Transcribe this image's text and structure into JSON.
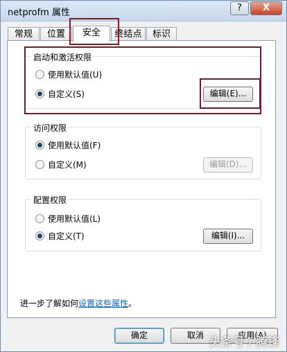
{
  "window": {
    "title": "netprofm 属性",
    "help_label": "?",
    "close_label": "X"
  },
  "tabs": [
    {
      "label": "常规"
    },
    {
      "label": "位置"
    },
    {
      "label": "安全"
    },
    {
      "label": "终结点"
    },
    {
      "label": "标识"
    }
  ],
  "active_tab": "安全",
  "launch_group": {
    "title": "启动和激活权限",
    "default_option": "使用默认值(U)",
    "custom_option": "自定义(S)",
    "edit_button": "编辑(E)...",
    "selected": "custom"
  },
  "access_group": {
    "title": "访问权限",
    "default_option": "使用默认值(F)",
    "custom_option": "自定义(M)",
    "edit_button": "编辑(D)...",
    "selected": "default"
  },
  "config_group": {
    "title": "配置权限",
    "default_option": "使用默认值(L)",
    "custom_option": "自定义(T)",
    "edit_button": "编辑(I)...",
    "selected": "custom"
  },
  "learn_more": {
    "prefix": "进一步了解如何",
    "link_text": "设置这些属性",
    "suffix": "。"
  },
  "buttons": {
    "ok": "确定",
    "cancel": "取消",
    "apply": "应用(A)"
  },
  "watermark": "头条号 / 腾锋",
  "colors": {
    "highlight_box": "#7b1822",
    "link": "#0066cc"
  }
}
